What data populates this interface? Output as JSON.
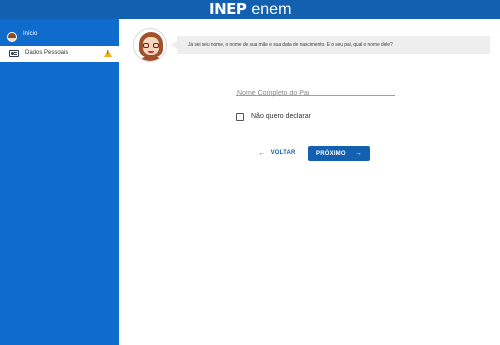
{
  "header": {
    "logo_inep": "INEP",
    "logo_enem": "enem",
    "brand_color": "#1460b0"
  },
  "sidebar": {
    "items": [
      {
        "label": "Início",
        "icon": "avatar-icon",
        "active": false
      },
      {
        "label": "Dados Pessoais",
        "icon": "id-card-icon",
        "active": true,
        "badge_icon": "warning-icon"
      }
    ],
    "bg_color": "#0f6ccc"
  },
  "assistant": {
    "message": "Já sei seu nome, o nome de sua mãe e sua data de nascimento. E o seu pai, qual o nome dele?"
  },
  "form": {
    "father_name_placeholder": "Nome Completo do Pai",
    "father_name_value": "",
    "no_declare_label": "Não quero declarar",
    "no_declare_checked": false
  },
  "actions": {
    "back_label": "VOLTAR",
    "back_icon": "arrow-left-icon",
    "next_label": "PRÓXIMO",
    "next_icon": "arrow-right-icon"
  }
}
